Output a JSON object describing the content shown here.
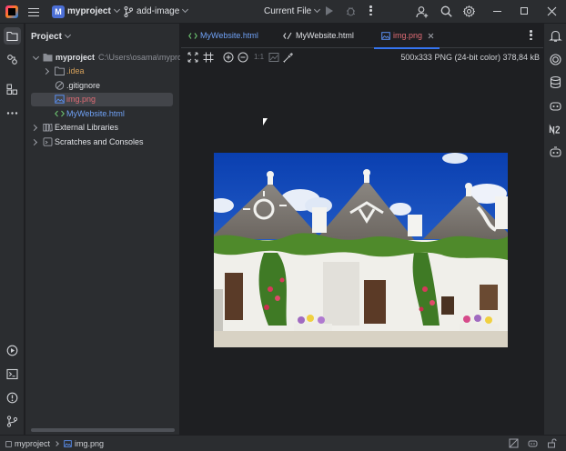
{
  "titlebar": {
    "project_initial": "M",
    "project_name": "myproject",
    "branch": "add-image",
    "run_config": "Current File"
  },
  "project_panel": {
    "header": "Project",
    "tree": [
      {
        "label": "myproject",
        "path": "C:\\Users\\osama\\mypro",
        "kind": "root-folder"
      },
      {
        "label": ".idea",
        "kind": "folder"
      },
      {
        "label": ".gitignore",
        "kind": "ignore-file"
      },
      {
        "label": "img.png",
        "kind": "image-file"
      },
      {
        "label": "MyWebsite.html",
        "kind": "html-file"
      },
      {
        "label": "External Libraries",
        "kind": "libraries"
      },
      {
        "label": "Scratches and Consoles",
        "kind": "scratches"
      }
    ]
  },
  "editor": {
    "tabs": [
      {
        "label": "MyWebsite.html",
        "color": "#6bbf6e"
      },
      {
        "label": "MyWebsite.html",
        "color": "#dfe1e5"
      },
      {
        "label": "img.png",
        "color": "#e06c75"
      }
    ],
    "image_info": "500x333 PNG (24-bit color) 378,84 kB",
    "zoom_label": "1:1"
  },
  "statusbar": {
    "breadcrumb_project": "myproject",
    "breadcrumb_file": "img.png"
  },
  "colors": {
    "accent": "#3574f0",
    "panel_bg": "#2b2d30",
    "editor_bg": "#1e1f22",
    "modified_file": "#e06c75",
    "html_file": "#6bbf6e",
    "folder_label": "#d5a05a"
  }
}
